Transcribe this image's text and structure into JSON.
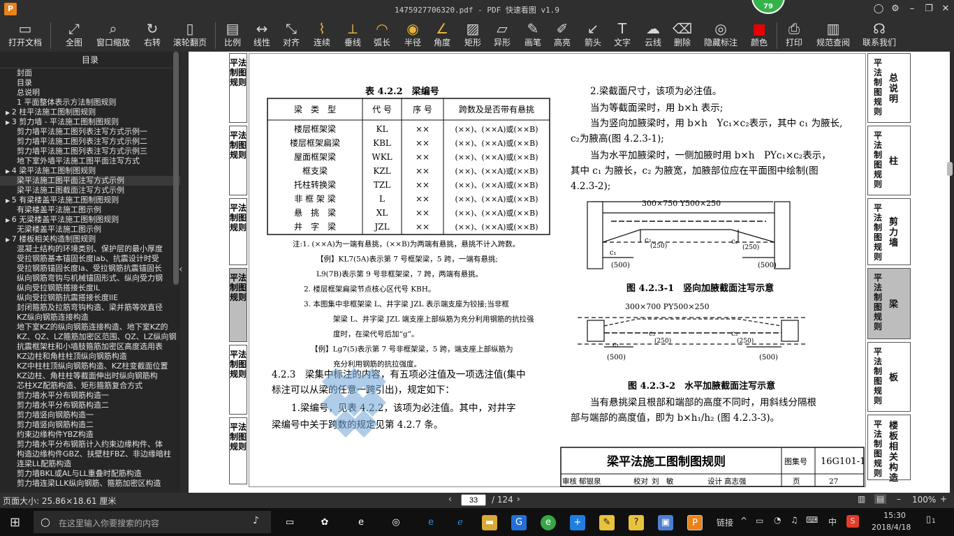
{
  "window": {
    "title": "1475927706320.pdf - PDF 快速看图 v1.9",
    "badge": "79"
  },
  "toolbar": [
    "打开文档",
    "全图",
    "窗口缩放",
    "右转",
    "滚轮翻页",
    "比例",
    "线性",
    "对齐",
    "连续",
    "垂线",
    "弧长",
    "半径",
    "角度",
    "矩形",
    "异形",
    "画笔",
    "高亮",
    "箭头",
    "文字",
    "云线",
    "删除",
    "隐藏标注",
    "颜色",
    "打印",
    "规范查阅",
    "联系我们"
  ],
  "sidebar": {
    "title": "目录",
    "items": [
      {
        "t": "封面",
        "a": false,
        "sel": false
      },
      {
        "t": "目录",
        "a": false,
        "sel": false
      },
      {
        "t": "总说明",
        "a": false,
        "sel": false
      },
      {
        "t": "1 平面整体表示方法制图规则",
        "a": false,
        "sel": false
      },
      {
        "t": "2 柱平法施工图制图规则",
        "a": true,
        "sel": false
      },
      {
        "t": "3 剪力墙 - 平法施工图制图规则",
        "a": true,
        "sel": false
      },
      {
        "t": "剪力墙平法施工图列表注写方式示例一",
        "a": false,
        "sel": false
      },
      {
        "t": "剪力墙平法施工图列表注写方式示例二",
        "a": false,
        "sel": false
      },
      {
        "t": "剪力墙平法施工图列表注写方式示例三",
        "a": false,
        "sel": false
      },
      {
        "t": "地下室外墙平法施工图平面注写方式",
        "a": false,
        "sel": false
      },
      {
        "t": "4 梁平法施工图制图规则",
        "a": true,
        "sel": false
      },
      {
        "t": "梁平法施工图平面注写方式示例",
        "a": false,
        "sel": true
      },
      {
        "t": "梁平法施工图截面注写方式示例",
        "a": false,
        "sel": false
      },
      {
        "t": "5 有梁楼盖平法施工图制图规则",
        "a": true,
        "sel": false
      },
      {
        "t": "有梁楼盖平法施工图示例",
        "a": false,
        "sel": false
      },
      {
        "t": "6 无梁楼盖平法施工图制图规则",
        "a": true,
        "sel": false
      },
      {
        "t": "无梁楼盖平法施工图示例",
        "a": false,
        "sel": false
      },
      {
        "t": "7 楼板相关构造制图规则",
        "a": true,
        "sel": false
      },
      {
        "t": "混凝土结构的环境类别、保护层的最小厚度",
        "a": false,
        "sel": false
      },
      {
        "t": "受拉钢筋基本锚固长度lab、抗震设计时受",
        "a": false,
        "sel": false
      },
      {
        "t": "受拉钢筋锚固长度la、受拉钢筋抗震锚固长",
        "a": false,
        "sel": false
      },
      {
        "t": "纵向钢筋弯钩与机械锚固形式、纵向受力钢",
        "a": false,
        "sel": false
      },
      {
        "t": "纵向受拉钢筋搭接长度lL",
        "a": false,
        "sel": false
      },
      {
        "t": "纵向受拉钢筋抗震搭接长度llE",
        "a": false,
        "sel": false
      },
      {
        "t": "封闭箍筋及拉筋弯钩构造、梁并筋等效直径",
        "a": false,
        "sel": false
      },
      {
        "t": "KZ纵向钢筋连接构造",
        "a": false,
        "sel": false
      },
      {
        "t": "地下室KZ的纵向钢筋连接构造、地下室KZ的",
        "a": false,
        "sel": false
      },
      {
        "t": "KZ、QZ、LZ箍筋加密区范围、QZ、LZ纵向钢",
        "a": false,
        "sel": false
      },
      {
        "t": "抗震框架柱和小墙肢箍筋加密区高度选用表",
        "a": false,
        "sel": false
      },
      {
        "t": "KZ边柱和角柱柱顶纵向钢筋构造",
        "a": false,
        "sel": false
      },
      {
        "t": "KZ中柱柱顶纵向钢筋构造、KZ柱变截面位置",
        "a": false,
        "sel": false
      },
      {
        "t": "KZ边柱、角柱柱等截面伸出时纵向钢筋构",
        "a": false,
        "sel": false
      },
      {
        "t": "芯柱XZ配筋构造、矩形箍筋复合方式",
        "a": false,
        "sel": false
      },
      {
        "t": "剪力墙水平分布钢筋构造一",
        "a": false,
        "sel": false
      },
      {
        "t": "剪力墙水平分布钢筋构造二",
        "a": false,
        "sel": false
      },
      {
        "t": "剪力墙竖向钢筋构造一",
        "a": false,
        "sel": false
      },
      {
        "t": "剪力墙竖向钢筋构造二",
        "a": false,
        "sel": false
      },
      {
        "t": "约束边缘构件YBZ构造",
        "a": false,
        "sel": false
      },
      {
        "t": "剪力墙水平分布钢筋计入约束边缘构件、体",
        "a": false,
        "sel": false
      },
      {
        "t": "构造边缘构件GBZ、扶壁柱FBZ、非边缘暗柱",
        "a": false,
        "sel": false
      },
      {
        "t": "连梁LL配筋构造",
        "a": false,
        "sel": false
      },
      {
        "t": "剪力墙BKL或AL与LL重叠时配筋构造",
        "a": false,
        "sel": false
      },
      {
        "t": "剪力墙连梁LLK纵向钢筋、箍筋加密区构造",
        "a": false,
        "sel": false
      }
    ]
  },
  "left_tabs": [
    "平法制图规则",
    "平法制图规则",
    "平法制图规则",
    "平法制图规则",
    "平法制图规则",
    "平法制图规则"
  ],
  "right_tabs": [
    {
      "v1": "平法制图规则",
      "v2": "总说明"
    },
    {
      "v1": "平法制图规则",
      "v2": "柱"
    },
    {
      "v1": "平法制图规则",
      "v2": "剪力墙"
    },
    {
      "v1": "平法制图规则",
      "v2": "梁"
    },
    {
      "v1": "平法制图规则",
      "v2": "板"
    },
    {
      "v1": "平法制图规则",
      "v2": "楼板相关构造"
    }
  ],
  "table": {
    "caption": "表 4.2.2　梁编号",
    "headers": [
      "梁　类　型",
      "代 号",
      "序 号",
      "跨数及是否带有悬挑"
    ],
    "rows": [
      [
        "楼层框架梁",
        "KL",
        "××",
        "(××)、(××A)或(××B)"
      ],
      [
        "楼层框架扁梁",
        "KBL",
        "××",
        "(××)、(××A)或(××B)"
      ],
      [
        "屋面框架梁",
        "WKL",
        "××",
        "(××)、(××A)或(××B)"
      ],
      [
        "框支梁",
        "KZL",
        "××",
        "(××)、(××A)或(××B)"
      ],
      [
        "托柱转换梁",
        "TZL",
        "××",
        "(××)、(××A)或(××B)"
      ],
      [
        "非 框 架 梁",
        "L",
        "××",
        "(××)、(××A)或(××B)"
      ],
      [
        "悬　挑　梁",
        "XL",
        "××",
        "(××)、(××A)或(××B)"
      ],
      [
        "井　字　梁",
        "JZL",
        "××",
        "(××)、(××A)或(××B)"
      ]
    ]
  },
  "notes": [
    "注:1. (××A)为一端有悬挑，(××B)为两端有悬挑，悬挑不计入跨数。",
    "【例】KL7(5A)表示第 7 号框架梁，5 跨，一端有悬挑;",
    "L9(7B)表示第 9 号非框架梁，7 跨，两端有悬挑。",
    "2. 楼层框架扁梁节点核心区代号 KBH。",
    "3. 本图集中非框架梁 L、井字梁 JZL 表示端支座为铰接;当非框",
    "架梁 L、井字梁 JZL 端支座上部纵筋为充分利用钢筋的抗拉强",
    "度时，在梁代号后加“g”。",
    "【例】Lg7(5)表示第 7 号非框架梁，5 跨，端支座上部纵筋为",
    "充分利用钢筋的抗拉强度。"
  ],
  "left_body": [
    "4.2.3　梁集中标注的内容，有五项必注值及一项选注值(集中",
    "标注可以从梁的任意一跨引出)，规定如下：",
    "1.梁编号，见表 4.2.2，该项为必注值。其中，对井字",
    "梁编号中关于跨数的规定见第 4.2.7 条。"
  ],
  "right_body": [
    "2.梁截面尺寸，该项为必注值。",
    "当为等截面梁时，用 b×h 表示;",
    "当为竖向加腋梁时，用 b×h　Yc₁×c₂表示，其中 c₁ 为腋长,",
    "c₂为腋高(图 4.2.3-1);",
    "当为水平加腋梁时，一侧加腋时用 b×h　PYc₁×c₂表示，",
    "其中 c₁ 为腋长，c₂ 为腋宽，加腋部位应在平面图中绘制(图",
    "4.2.3-2);"
  ],
  "fig1": {
    "label": "300×750 Y500×250",
    "c1": "c₁",
    "c2": "c₂",
    "v250": "(250)",
    "v500": "(500)",
    "caption": "图 4.2.3-1　竖向加腋截面注写示意"
  },
  "fig2": {
    "label": "300×700 PY500×250",
    "c1": "c₁",
    "c2": "c₂",
    "v250": "(250)",
    "v500": "(500)",
    "caption": "图 4.2.3-2　水平加腋截面注写示意"
  },
  "bottom_text": [
    "当有悬挑梁且根部和端部的高度不同时，用斜线分隔根",
    "部与端部的高度值，即为 b×h₁/h₂ (图 4.2.3-3)。"
  ],
  "titleblock": {
    "title": "梁平法施工图制图规则",
    "atlas_label": "图集号",
    "atlas": "16G101-1",
    "row": [
      "审核",
      "郁银泉",
      "校对",
      "刘　敏",
      "设计",
      "高志强",
      "页",
      "27"
    ]
  },
  "status": {
    "page_size": "页面大小: 25.86×18.61 厘米",
    "page": "33",
    "total": "/ 124",
    "zoom": "100%"
  },
  "taskbar": {
    "search": "在这里输入你要搜索的内容",
    "link": "链接",
    "ime": "中",
    "time": "15:30",
    "date": "2018/4/18",
    "notif": "1"
  }
}
